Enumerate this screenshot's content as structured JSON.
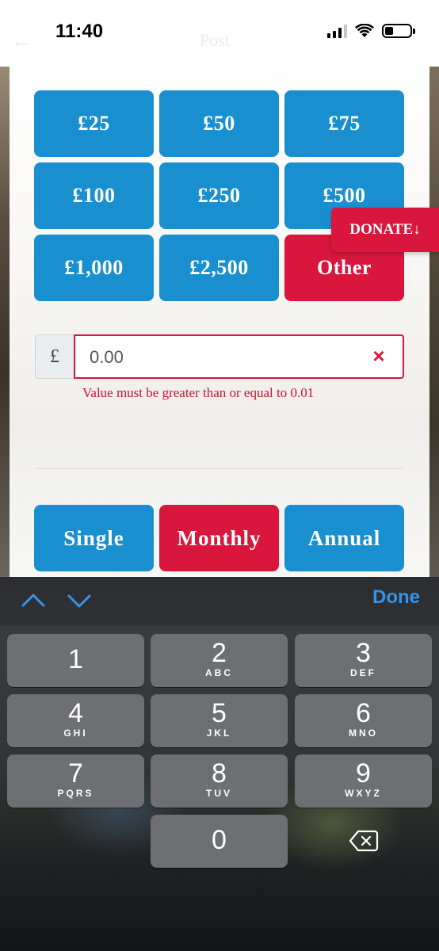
{
  "status": {
    "time": "11:40",
    "ghost_title": "Post",
    "ghost_back": "←"
  },
  "amounts": [
    "£25",
    "£50",
    "£75",
    "£100",
    "£250",
    "£500",
    "£1,000",
    "£2,500",
    "Other"
  ],
  "donate_tab": "DONATE↓",
  "custom_amount": {
    "currency_symbol": "£",
    "value": "0.00",
    "clear_icon": "×",
    "error": "Value must be greater than or equal to 0.01"
  },
  "frequency": [
    "Single",
    "Monthly",
    "Annual"
  ],
  "keyboard": {
    "done_label": "Done",
    "keys": [
      {
        "num": "1",
        "letters": ""
      },
      {
        "num": "2",
        "letters": "ABC"
      },
      {
        "num": "3",
        "letters": "DEF"
      },
      {
        "num": "4",
        "letters": "GHI"
      },
      {
        "num": "5",
        "letters": "JKL"
      },
      {
        "num": "6",
        "letters": "MNO"
      },
      {
        "num": "7",
        "letters": "PQRS"
      },
      {
        "num": "8",
        "letters": "TUV"
      },
      {
        "num": "9",
        "letters": "WXYZ"
      },
      {
        "num": "0",
        "letters": ""
      }
    ]
  },
  "colors": {
    "blue": "#1a8fd0",
    "red": "#d9173c",
    "link": "#3395ea"
  }
}
